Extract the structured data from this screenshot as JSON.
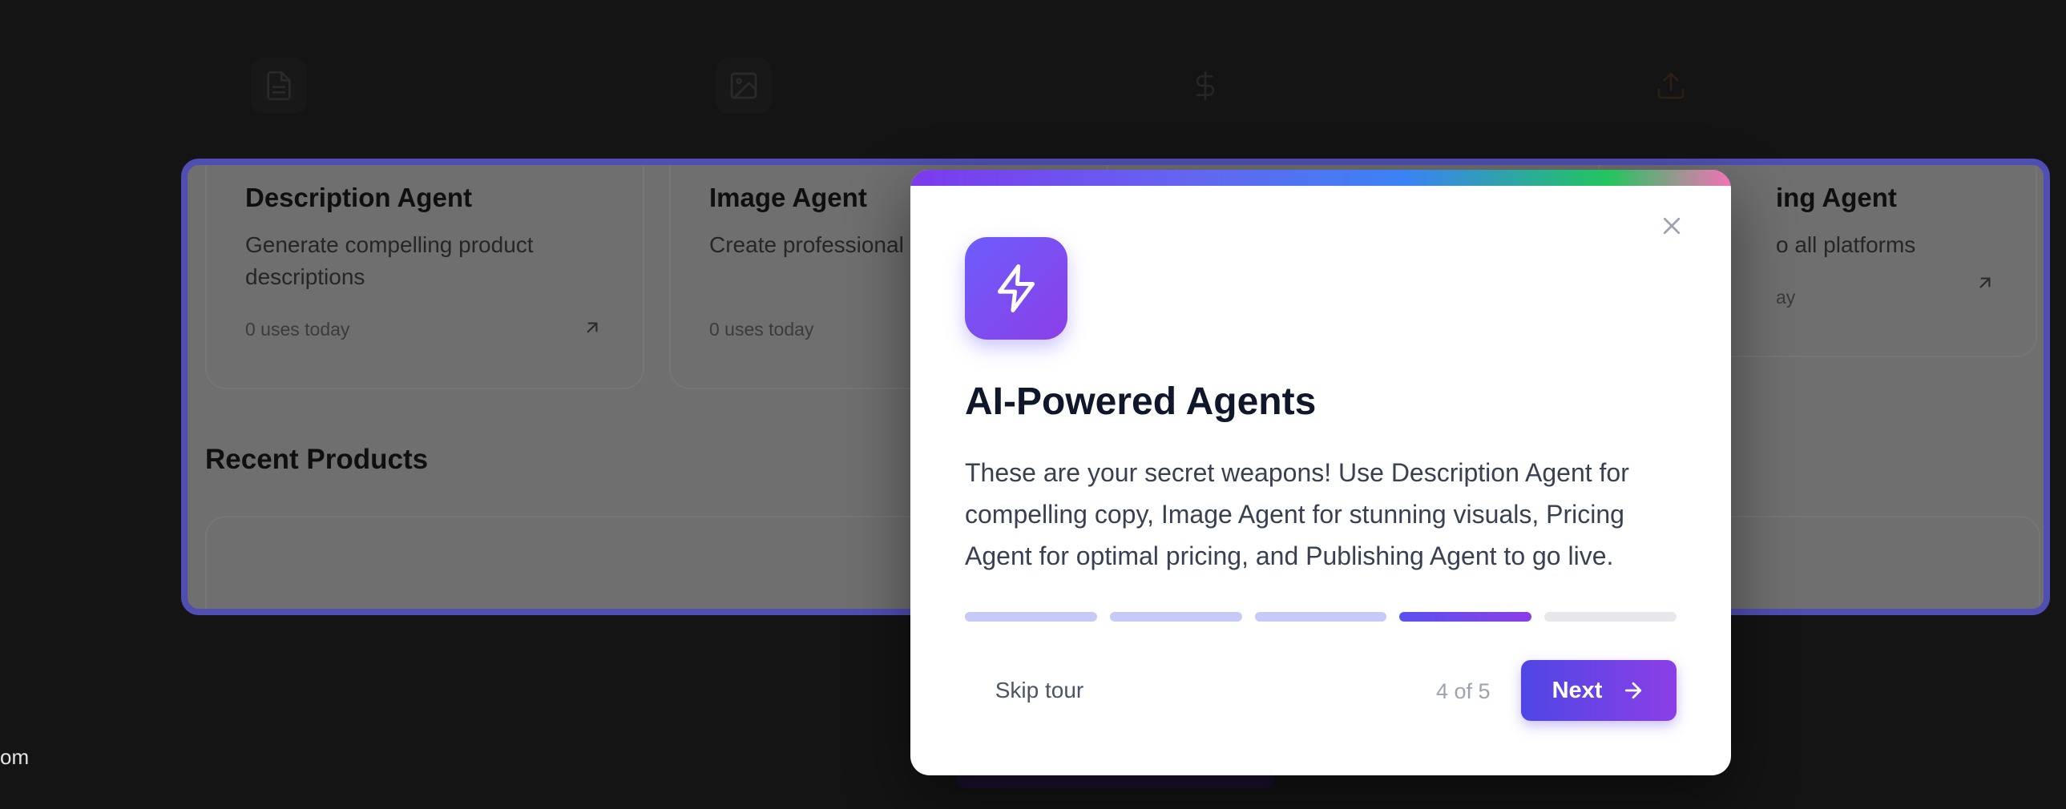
{
  "background": {
    "cards": [
      {
        "title": "Description Agent",
        "description": "Generate compelling product descriptions",
        "uses": "0 uses today"
      },
      {
        "title": "Image Agent",
        "description": "Create professional photos",
        "uses": "0 uses today"
      },
      {
        "title": "ing Agent",
        "description": "o all platforms",
        "uses": "ay"
      }
    ],
    "icons": [
      "document-icon",
      "image-icon",
      "dollar-icon",
      "upload-icon"
    ],
    "section_title": "Recent Products",
    "bottom_fragment": "om"
  },
  "modal": {
    "title": "AI-Powered Agents",
    "body": "These are your secret weapons! Use Description Agent for compelling copy, Image Agent for stunning visuals, Pricing Agent for optimal pricing, and Publishing Agent to go live.",
    "icon": "lightning-icon",
    "skip_label": "Skip tour",
    "step_label": "4 of 5",
    "next_label": "Next",
    "progress": {
      "current_step": 4,
      "total_steps": 5
    },
    "colors": {
      "accent_start": "#4f46e5",
      "accent_end": "#8b3fe6",
      "spotlight_border": "#4f4fb3"
    }
  }
}
